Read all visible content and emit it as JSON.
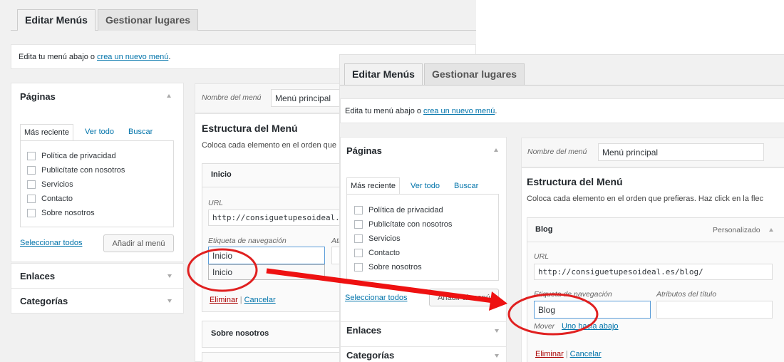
{
  "back": {
    "tabs": {
      "edit": "Editar Menús",
      "manage": "Gestionar lugares"
    },
    "notice": {
      "text": "Edita tu menú abajo o",
      "link": "crea un nuevo menú",
      "suffix": "."
    },
    "pages_box": {
      "title": "Páginas",
      "tabs": [
        "Más reciente",
        "Ver todo",
        "Buscar"
      ],
      "items": [
        "Política de privacidad",
        "Publicítate con nosotros",
        "Servicios",
        "Contacto",
        "Sobre nosotros"
      ],
      "select_all": "Seleccionar todos",
      "add_button": "Añadir al menú"
    },
    "links_box": {
      "title": "Enlaces"
    },
    "categories_box": {
      "title": "Categorías"
    },
    "menu": {
      "name_label": "Nombre del menú",
      "name_value": "Menú principal",
      "structure_heading": "Estructura del Menú",
      "structure_desc": "Coloca cada elemento en el orden que",
      "item": {
        "title": "Inicio",
        "url_label": "URL",
        "url_value": "http://consiguetupesoideal.",
        "nav_label": "Etiqueta de navegación",
        "attr_label_partial": "Atr",
        "nav_value": "Inicio",
        "autocomplete": "Inicio",
        "delete": "Eliminar",
        "separator": "|",
        "cancel": "Cancelar"
      },
      "next_item": "Sobre nosotros"
    }
  },
  "front": {
    "tabs": {
      "edit": "Editar Menús",
      "manage": "Gestionar lugares"
    },
    "notice": {
      "text": "Edita tu menú abajo o",
      "link": "crea un nuevo menú",
      "suffix": "."
    },
    "pages_box": {
      "title": "Páginas",
      "tabs": [
        "Más reciente",
        "Ver todo",
        "Buscar"
      ],
      "items": [
        "Política de privacidad",
        "Publicítate con nosotros",
        "Servicios",
        "Contacto",
        "Sobre nosotros"
      ],
      "select_all": "Seleccionar todos",
      "add_button": "Añadir al menú"
    },
    "links_box": {
      "title": "Enlaces"
    },
    "categories_box": {
      "title": "Categorías"
    },
    "menu": {
      "name_label": "Nombre del menú",
      "name_value": "Menú principal",
      "structure_heading": "Estructura del Menú",
      "structure_desc": "Coloca cada elemento en el orden que prefieras. Haz click en la flec",
      "item": {
        "title": "Blog",
        "type": "Personalizado",
        "url_label": "URL",
        "url_value": "http://consiguetupesoideal.es/blog/",
        "nav_label": "Etiqueta de navegación",
        "attr_label": "Atributos del título",
        "nav_value": "Blog",
        "move_label": "Mover",
        "move_link": "Uno hacia abajo",
        "delete": "Eliminar",
        "separator": "|",
        "cancel": "Cancelar"
      }
    }
  },
  "annotation_colors": {
    "circle": "#e02020",
    "arrow": "#ee1111"
  }
}
